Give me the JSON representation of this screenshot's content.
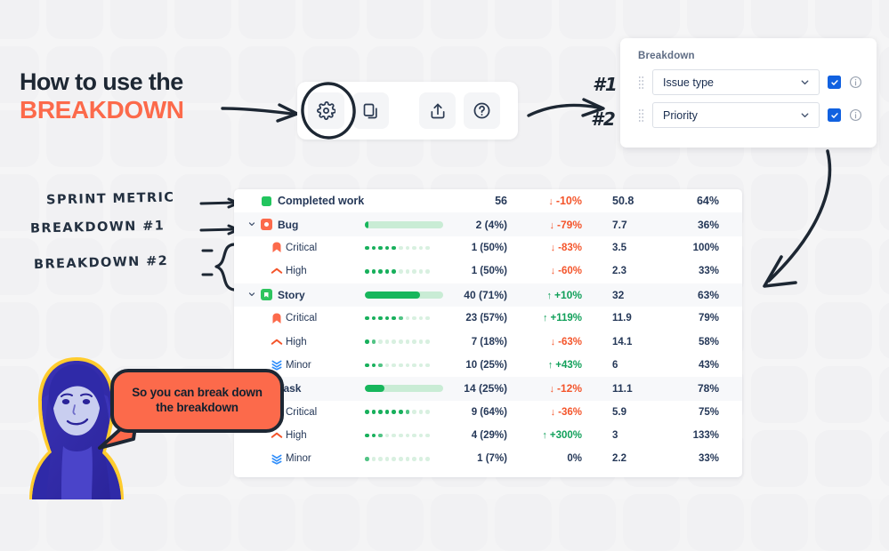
{
  "title": {
    "line1": "How to use the",
    "line2": "BREAKDOWN",
    "accent_color": "#fc6a4b",
    "dark_color": "#1d2733"
  },
  "annotations": {
    "sprint_metric": "SPRINT METRIC",
    "breakdown_1": "BREAKDOWN #1",
    "breakdown_2": "BREAKDOWN #2",
    "hash_1": "#1",
    "hash_2": "#2"
  },
  "toolbar": {
    "buttons": [
      {
        "name": "settings-icon",
        "label": "gear-icon",
        "highlighted": true
      },
      {
        "name": "duplicate-icon",
        "label": "copy-icon",
        "highlighted": false
      },
      {
        "name": "share-icon",
        "label": "export-icon",
        "highlighted": false
      },
      {
        "name": "help-icon",
        "label": "question-icon",
        "highlighted": false
      }
    ]
  },
  "breakdown_panel": {
    "title": "Breakdown",
    "rows": [
      {
        "value": "Issue type",
        "checked": true,
        "info": "i"
      },
      {
        "value": "Priority",
        "checked": true,
        "info": "i"
      }
    ]
  },
  "bubble": {
    "line1": "So you can break down",
    "line2": "the breakdown",
    "fill": "#fc6a4b",
    "stroke": "#1d2733"
  },
  "table": {
    "rows": [
      {
        "level": 0,
        "caret": "",
        "icon": "square-green",
        "name": "Completed work",
        "bar": null,
        "value": "56",
        "change": "-10%",
        "dir": "down",
        "avg": "50.8",
        "pct": "64%",
        "shade": false
      },
      {
        "level": 1,
        "caret": "v",
        "icon": "bug",
        "name": "Bug",
        "bar": {
          "type": "solid",
          "fill": 4
        },
        "value": "2 (4%)",
        "change": "-79%",
        "dir": "down",
        "avg": "7.7",
        "pct": "36%",
        "shade": true
      },
      {
        "level": 2,
        "caret": "",
        "icon": "critical",
        "name": "Critical",
        "bar": {
          "type": "dots",
          "fill": 50
        },
        "value": "1 (50%)",
        "change": "-83%",
        "dir": "down",
        "avg": "3.5",
        "pct": "100%",
        "shade": false
      },
      {
        "level": 2,
        "caret": "",
        "icon": "high",
        "name": "High",
        "bar": {
          "type": "dots",
          "fill": 50
        },
        "value": "1 (50%)",
        "change": "-60%",
        "dir": "down",
        "avg": "2.3",
        "pct": "33%",
        "shade": false
      },
      {
        "level": 1,
        "caret": "v",
        "icon": "story",
        "name": "Story",
        "bar": {
          "type": "solid",
          "fill": 71
        },
        "value": "40 (71%)",
        "change": "+10%",
        "dir": "up",
        "avg": "32",
        "pct": "63%",
        "shade": true
      },
      {
        "level": 2,
        "caret": "",
        "icon": "critical",
        "name": "Critical",
        "bar": {
          "type": "dots",
          "fill": 57
        },
        "value": "23 (57%)",
        "change": "+119%",
        "dir": "up",
        "avg": "11.9",
        "pct": "79%",
        "shade": false
      },
      {
        "level": 2,
        "caret": "",
        "icon": "high",
        "name": "High",
        "bar": {
          "type": "dots",
          "fill": 18
        },
        "value": "7 (18%)",
        "change": "-63%",
        "dir": "down",
        "avg": "14.1",
        "pct": "58%",
        "shade": false
      },
      {
        "level": 2,
        "caret": "",
        "icon": "minor",
        "name": "Minor",
        "bar": {
          "type": "dots",
          "fill": 25
        },
        "value": "10 (25%)",
        "change": "+43%",
        "dir": "up",
        "avg": "6",
        "pct": "43%",
        "shade": false
      },
      {
        "level": 1,
        "caret": "v",
        "icon": "task",
        "name": "Task",
        "bar": {
          "type": "solid",
          "fill": 25
        },
        "value": "14 (25%)",
        "change": "-12%",
        "dir": "down",
        "avg": "11.1",
        "pct": "78%",
        "shade": true
      },
      {
        "level": 2,
        "caret": "",
        "icon": "critical",
        "name": "Critical",
        "bar": {
          "type": "dots",
          "fill": 64
        },
        "value": "9 (64%)",
        "change": "-36%",
        "dir": "down",
        "avg": "5.9",
        "pct": "75%",
        "shade": false
      },
      {
        "level": 2,
        "caret": "",
        "icon": "high",
        "name": "High",
        "bar": {
          "type": "dots",
          "fill": 29
        },
        "value": "4 (29%)",
        "change": "+300%",
        "dir": "up",
        "avg": "3",
        "pct": "133%",
        "shade": false
      },
      {
        "level": 2,
        "caret": "",
        "icon": "minor",
        "name": "Minor",
        "bar": {
          "type": "dots",
          "fill": 7
        },
        "value": "1 (7%)",
        "change": "0%",
        "dir": "flat",
        "avg": "2.2",
        "pct": "33%",
        "shade": false
      }
    ]
  },
  "colors": {
    "green": "#17b65c",
    "orange": "#fc6a4b",
    "red_down": "#f4552b",
    "green_up": "#11a05a",
    "blue_check": "#1161e0",
    "ink": "#1d2733"
  }
}
